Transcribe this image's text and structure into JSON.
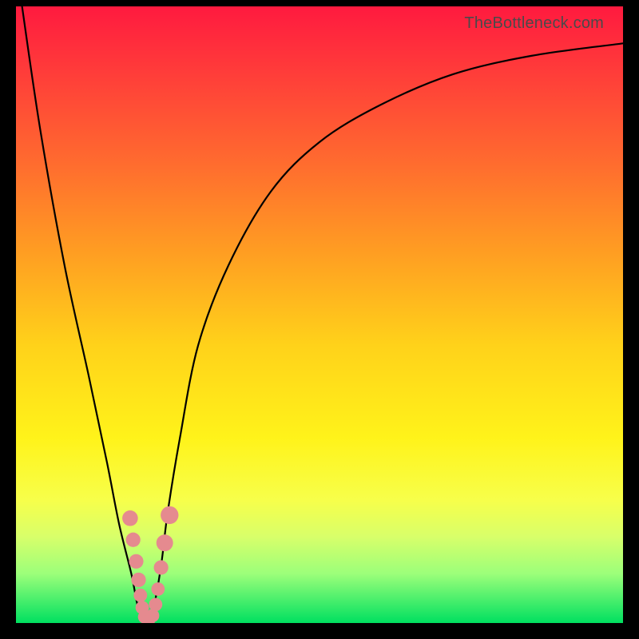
{
  "watermark": "TheBottleneck.com",
  "chart_data": {
    "type": "line",
    "title": "",
    "xlabel": "",
    "ylabel": "",
    "xlim": [
      0,
      100
    ],
    "ylim": [
      0,
      100
    ],
    "series": [
      {
        "name": "bottleneck-curve",
        "x": [
          1,
          4,
          8,
          12,
          15,
          17,
          19,
          20,
          21,
          22,
          23,
          24,
          25,
          27,
          30,
          35,
          42,
          50,
          60,
          72,
          85,
          100
        ],
        "values": [
          100,
          80,
          58,
          40,
          26,
          16,
          8,
          3,
          0,
          0,
          4,
          10,
          18,
          30,
          45,
          58,
          70,
          78,
          84,
          89,
          92,
          94
        ]
      }
    ],
    "markers": {
      "name": "highlight-points",
      "color": "#e58a8f",
      "points": [
        {
          "x": 18.8,
          "y": 17.0,
          "r": 1.4
        },
        {
          "x": 19.3,
          "y": 13.5,
          "r": 1.3
        },
        {
          "x": 19.8,
          "y": 10.0,
          "r": 1.3
        },
        {
          "x": 20.2,
          "y": 7.0,
          "r": 1.3
        },
        {
          "x": 20.5,
          "y": 4.5,
          "r": 1.2
        },
        {
          "x": 20.8,
          "y": 2.5,
          "r": 1.2
        },
        {
          "x": 21.2,
          "y": 1.0,
          "r": 1.2
        },
        {
          "x": 21.8,
          "y": 0.4,
          "r": 1.2
        },
        {
          "x": 22.5,
          "y": 1.2,
          "r": 1.2
        },
        {
          "x": 23.0,
          "y": 3.0,
          "r": 1.2
        },
        {
          "x": 23.4,
          "y": 5.5,
          "r": 1.2
        },
        {
          "x": 23.9,
          "y": 9.0,
          "r": 1.3
        },
        {
          "x": 24.5,
          "y": 13.0,
          "r": 1.5
        },
        {
          "x": 25.3,
          "y": 17.5,
          "r": 1.6
        }
      ]
    },
    "gradient_stops": [
      {
        "pos": 0,
        "color": "#ff1a3f"
      },
      {
        "pos": 25,
        "color": "#ff6a2f"
      },
      {
        "pos": 55,
        "color": "#ffd21a"
      },
      {
        "pos": 80,
        "color": "#f7ff4a"
      },
      {
        "pos": 100,
        "color": "#00e060"
      }
    ]
  }
}
